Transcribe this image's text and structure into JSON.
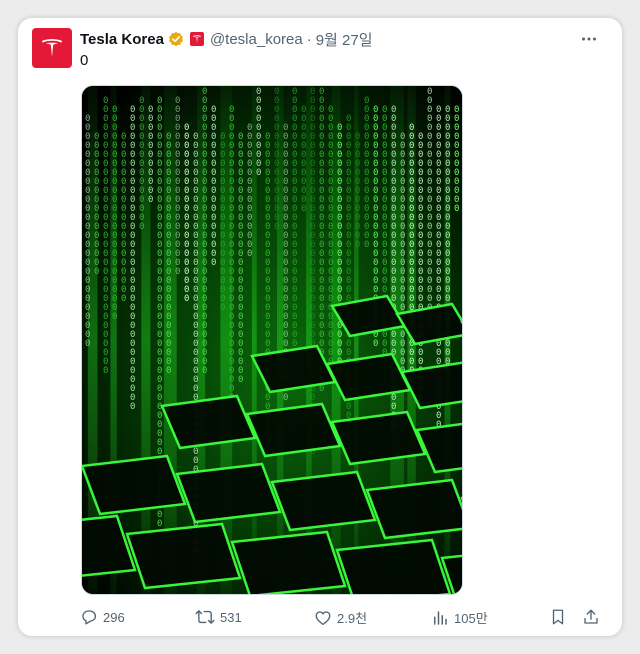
{
  "tweet": {
    "author_name": "Tesla Korea",
    "handle": "@tesla_korea",
    "separator": "·",
    "date": "9월 27일",
    "text": "0",
    "media_description_icon": "matrix-keyboard-image",
    "brand_color": "#e31937",
    "verified_color": "#e8a90c"
  },
  "actions": {
    "replies": "296",
    "retweets": "531",
    "likes": "2.9천",
    "views": "105만"
  },
  "icons": [
    "tesla-logo-icon",
    "verified-badge-icon",
    "affiliate-badge-icon",
    "more-icon",
    "reply-icon",
    "retweet-icon",
    "like-icon",
    "views-icon",
    "bookmark-icon",
    "share-icon"
  ]
}
